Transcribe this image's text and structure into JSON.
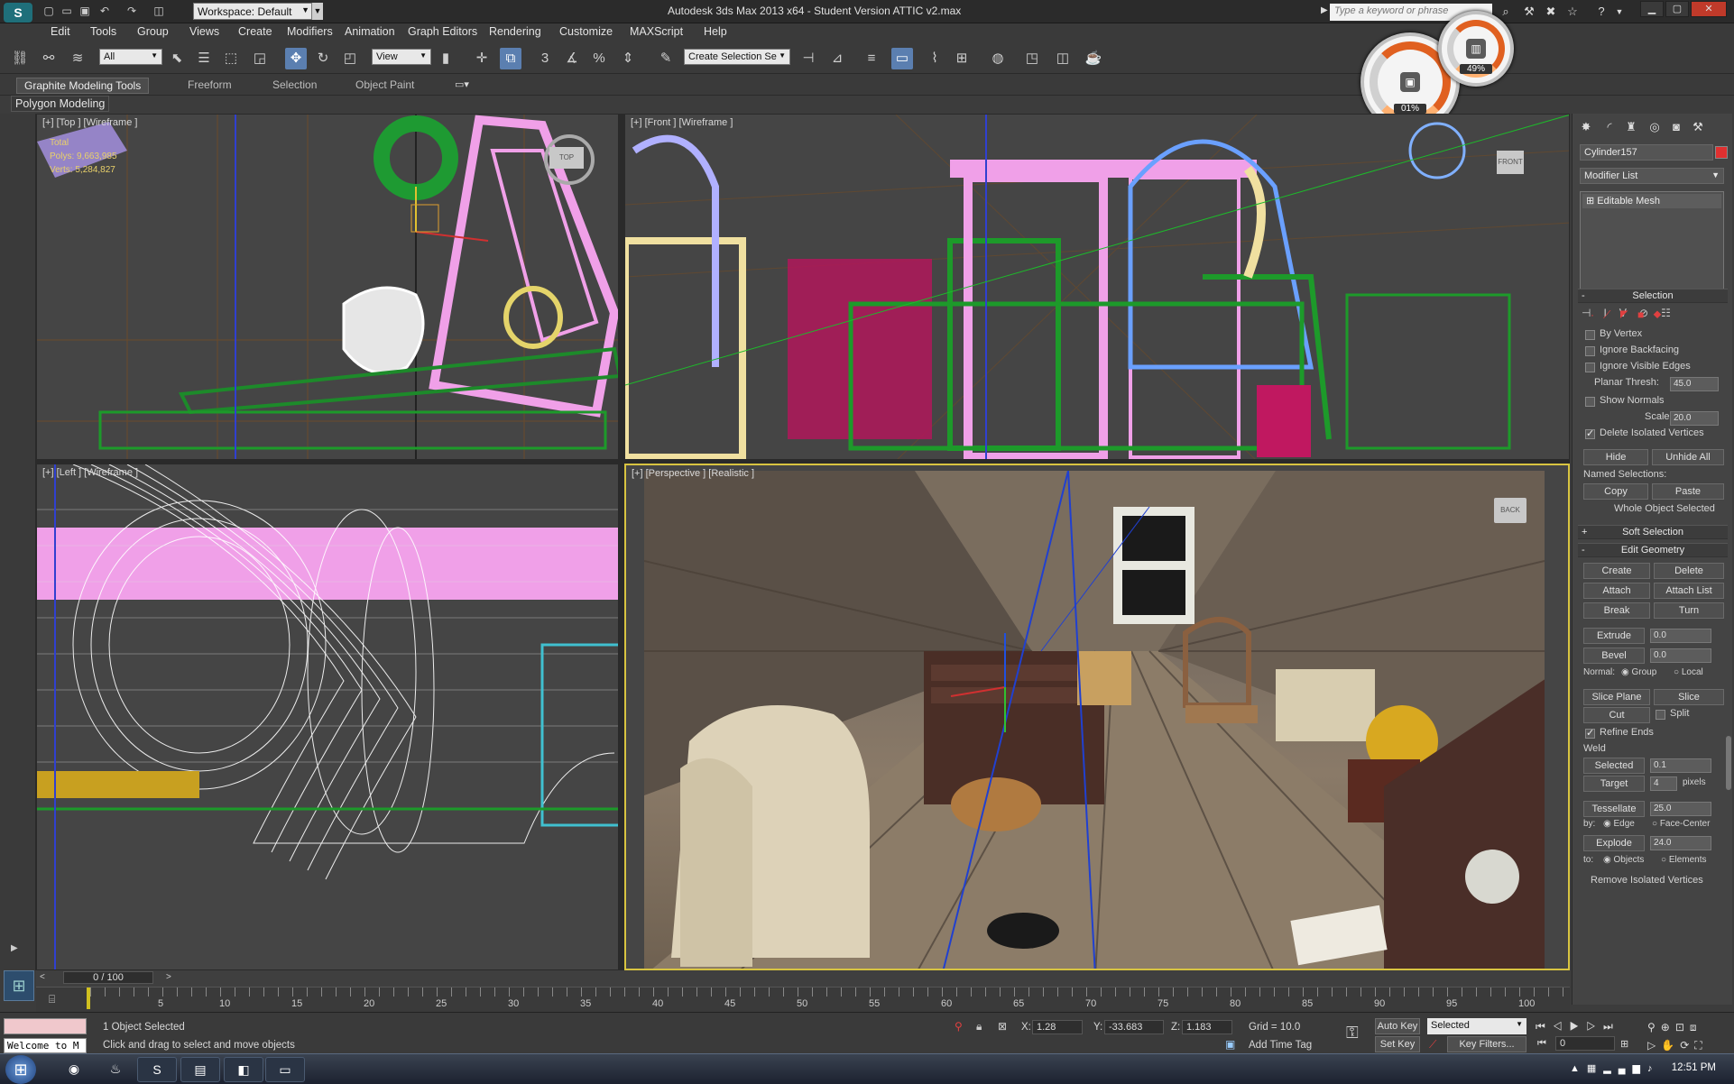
{
  "window": {
    "title": "Autodesk 3ds Max  2013 x64  - Student Version   ATTIC v2.max",
    "search_placeholder": "Type a keyword or phrase"
  },
  "workspace": {
    "label": "Workspace: Default"
  },
  "menu": [
    "Edit",
    "Tools",
    "Group",
    "Views",
    "Create",
    "Modifiers",
    "Animation",
    "Graph Editors",
    "Rendering",
    "Customize",
    "MAXScript",
    "Help"
  ],
  "toolbar": {
    "selection_filter": "All",
    "ref_coord": "View",
    "named_selection": "Create Selection Se"
  },
  "ribbon": {
    "tabs": [
      "Graphite Modeling Tools",
      "Freeform",
      "Selection",
      "Object Paint"
    ],
    "panel": "Polygon Modeling"
  },
  "gauges": {
    "cpu_pct": "01%",
    "mem_pct": "49%"
  },
  "viewports": {
    "top": {
      "label": "[+] [Top ] [Wireframe ]",
      "stats": {
        "total": "Total",
        "polys_label": "Polys:",
        "polys": "9,663,985",
        "verts_label": "Verts:",
        "verts": "5,284,827"
      },
      "viewcube": "TOP"
    },
    "front": {
      "label": "[+] [Front ] [Wireframe ]",
      "viewcube": "FRONT"
    },
    "left": {
      "label": "[+] [Left ] [Wireframe ]"
    },
    "persp": {
      "label": "[+] [Perspective ] [Realistic ]",
      "viewcube": "BACK"
    }
  },
  "command_panel": {
    "object_name": "Cylinder157",
    "modifier_list": "Modifier List",
    "stack": [
      "Editable Mesh"
    ],
    "selection": {
      "title": "Selection",
      "by_vertex": "By Vertex",
      "ignore_backfacing": "Ignore Backfacing",
      "ignore_visible_edges": "Ignore Visible Edges",
      "planar_thresh_label": "Planar Thresh:",
      "planar_thresh": "45.0",
      "show_normals": "Show Normals",
      "scale_label": "Scale:",
      "scale": "20.0",
      "delete_isolated": "Delete Isolated Vertices",
      "hide": "Hide",
      "unhide_all": "Unhide All",
      "named_selections": "Named Selections:",
      "copy": "Copy",
      "paste": "Paste",
      "whole_object": "Whole Object Selected"
    },
    "soft_selection": "Soft Selection",
    "edit_geometry": {
      "title": "Edit Geometry",
      "create": "Create",
      "delete": "Delete",
      "attach": "Attach",
      "attach_list": "Attach List",
      "break": "Break",
      "turn": "Turn",
      "extrude": "Extrude",
      "extrude_val": "0.0",
      "bevel": "Bevel",
      "bevel_val": "0.0",
      "normal_label": "Normal:",
      "group": "Group",
      "local": "Local",
      "slice_plane": "Slice Plane",
      "slice": "Slice",
      "cut": "Cut",
      "split": "Split",
      "refine_ends": "Refine Ends",
      "weld": "Weld",
      "selected": "Selected",
      "selected_val": "0.1",
      "target": "Target",
      "target_val": "4",
      "pixels": "pixels",
      "tessellate": "Tessellate",
      "tessellate_val": "25.0",
      "by_label": "by:",
      "edge": "Edge",
      "face_center": "Face-Center",
      "explode": "Explode",
      "explode_val": "24.0",
      "to_label": "to:",
      "objects": "Objects",
      "elements": "Elements",
      "remove_isolated": "Remove Isolated Vertices"
    }
  },
  "timeline": {
    "frame": "0 / 100",
    "ticks": [
      "5",
      "10",
      "15",
      "20",
      "25",
      "30",
      "35",
      "40",
      "45",
      "50",
      "55",
      "60",
      "65",
      "70",
      "75",
      "80",
      "85",
      "90",
      "95",
      "100"
    ]
  },
  "status": {
    "selected": "1 Object Selected",
    "prompt": "Click and drag to select and move objects",
    "welcome": "Welcome to M",
    "x": "1.28",
    "y": "-33.683",
    "z": "1.183",
    "grid": "Grid = 10.0",
    "add_time_tag": "Add Time Tag",
    "auto_key": "Auto Key",
    "set_key": "Set Key",
    "key_mode": "Selected",
    "key_filters": "Key Filters...",
    "frame_field": "0"
  },
  "taskbar": {
    "clock": "12:51 PM"
  }
}
